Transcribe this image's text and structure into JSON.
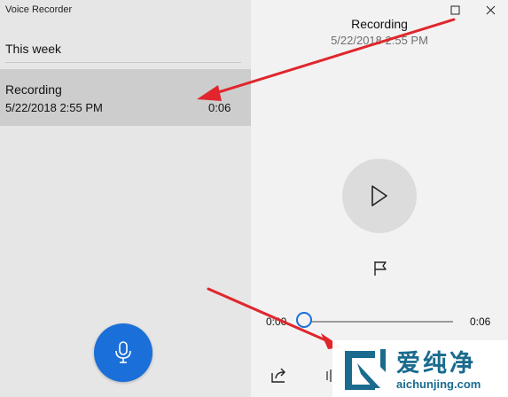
{
  "app": {
    "title": "Voice Recorder"
  },
  "list": {
    "group_header": "This week",
    "items": [
      {
        "title": "Recording",
        "date": "5/22/2018 2:55 PM",
        "duration": "0:06"
      }
    ]
  },
  "detail": {
    "title": "Recording",
    "date": "5/22/2018 2:55 PM",
    "time_current": "0:00",
    "time_total": "0:06",
    "progress": 0.0
  },
  "icons": {
    "record": "microphone-icon",
    "play": "play-icon",
    "marker": "flag-icon",
    "share": "share-icon",
    "trim": "trim-icon",
    "maximize": "maximize-icon",
    "close": "close-icon"
  },
  "colors": {
    "accent": "#1a6fd8",
    "selection": "#cdcdcd",
    "annotation_arrow": "#e0262c",
    "watermark": "#1a6b8e"
  },
  "watermark": {
    "brand_cn": "爱纯净",
    "url": "aichunjing.com"
  }
}
